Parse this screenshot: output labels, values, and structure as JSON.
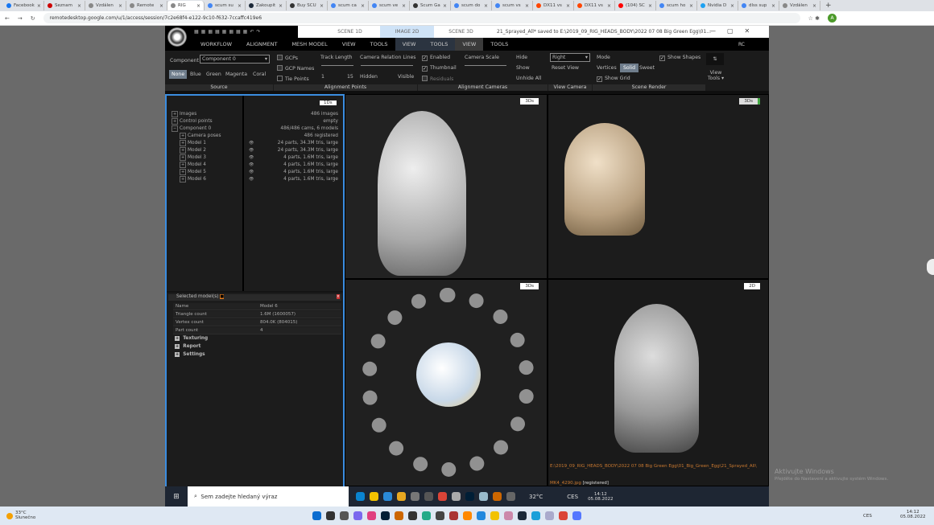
{
  "browser": {
    "tabs": [
      {
        "label": "Facebook",
        "color": "#1877f2"
      },
      {
        "label": "Seznam",
        "color": "#cc0000"
      },
      {
        "label": "Vzdálen",
        "color": "#888888"
      },
      {
        "label": "Remote",
        "color": "#888888"
      },
      {
        "label": "RIG",
        "color": "#888888",
        "active": true
      },
      {
        "label": "scum su",
        "color": "#4285f4"
      },
      {
        "label": "Zakoupit",
        "color": "#1b2838"
      },
      {
        "label": "Buy SCU",
        "color": "#333333"
      },
      {
        "label": "scum ca",
        "color": "#4285f4"
      },
      {
        "label": "scum ve",
        "color": "#4285f4"
      },
      {
        "label": "Scum Ga",
        "color": "#333333"
      },
      {
        "label": "scum do",
        "color": "#4285f4"
      },
      {
        "label": "scum vs",
        "color": "#4285f4"
      },
      {
        "label": "DX11 vs",
        "color": "#ff4500"
      },
      {
        "label": "DX11 vs",
        "color": "#ff4500"
      },
      {
        "label": "(104) SC",
        "color": "#ff0000"
      },
      {
        "label": "scum ho",
        "color": "#4285f4"
      },
      {
        "label": "Nvidia D",
        "color": "#1da1f2"
      },
      {
        "label": "dlss sup",
        "color": "#4285f4"
      },
      {
        "label": "Vzdálen",
        "color": "#888888"
      }
    ],
    "new_tab": "+",
    "url": "remotedesktop.google.com/u/1/access/session/7c2e68f4-e122-9c10-f632-7ccaffc419e6",
    "profile_initial": "A"
  },
  "app": {
    "scene_tabs": [
      "SCENE 1D",
      "IMAGE 2D",
      "SCENE 3D"
    ],
    "title": "21_Sprayed_All* saved to E:\\2019_09_RIG_HEADS_BODY\\2022 07 08 Big Green Egg\\01...",
    "menu": [
      "WORKFLOW",
      "ALIGNMENT",
      "MESH MODEL",
      "VIEW",
      "TOOLS",
      "VIEW",
      "TOOLS",
      "VIEW",
      "TOOLS"
    ],
    "menu_right": "RC",
    "ribbon": {
      "component_label": "Component",
      "component_value": "Component 0",
      "colors": [
        "None",
        "Blue",
        "Green",
        "Magenta",
        "Coral"
      ],
      "gcps": "GCPs",
      "gcp_names": "GCP Names",
      "tie_points": "Tie Points",
      "track_length": "Track Length",
      "track_min": "1",
      "track_max": "15",
      "camera_relation": "Camera Relation Lines",
      "hidden": "Hidden",
      "visible": "Visible",
      "enabled": "Enabled",
      "thumbnail": "Thumbnail",
      "residuals": "Residuals",
      "camera_scale": "Camera Scale",
      "hide": "Hide",
      "show": "Show",
      "unhide_all": "Unhide All",
      "view_select": "Right",
      "reset_view": "Reset View",
      "mode": "Mode",
      "vertices": "Vertices",
      "solid": "Solid",
      "sweet": "Sweet",
      "show_shapes": "Show Shapes",
      "show_grid": "Show Grid",
      "view_tools": "View Tools ▾",
      "groups": [
        "Source",
        "Alignment Points",
        "Alignment Cameras",
        "View Camera",
        "Scene Render"
      ]
    },
    "tree": {
      "badge": "1Ds",
      "items": [
        {
          "label": "Images",
          "value": "486 images",
          "indent": 0
        },
        {
          "label": "Control points",
          "value": "empty",
          "indent": 0
        },
        {
          "label": "Component 0",
          "value": "486/486 cams, 6 models",
          "indent": 0
        },
        {
          "label": "Camera poses",
          "value": "486 registered",
          "indent": 1
        },
        {
          "label": "Model 1",
          "value": "24 parts, 34.3M tris, large",
          "indent": 1
        },
        {
          "label": "Model 2",
          "value": "24 parts, 34.3M tris, large",
          "indent": 1
        },
        {
          "label": "Model 3",
          "value": "4 parts, 1.6M tris, large",
          "indent": 1
        },
        {
          "label": "Model 4",
          "value": "4 parts, 1.6M tris, large",
          "indent": 1
        },
        {
          "label": "Model 5",
          "value": "4 parts, 1.6M tris, large",
          "indent": 1
        },
        {
          "label": "Model 6",
          "value": "4 parts, 1.6M tris, large",
          "indent": 1
        }
      ]
    },
    "selected": {
      "title": "Selected model(s)",
      "rows": [
        [
          "Name",
          "Model 6"
        ],
        [
          "Triangle count",
          "1.6M (1600057)"
        ],
        [
          "Vertex count",
          "804.0K (804015)"
        ],
        [
          "Part count",
          "4"
        ]
      ],
      "sections": [
        "Texturing",
        "Report",
        "Settings"
      ]
    },
    "viewports": {
      "badges": [
        "3Ds",
        "3Ds",
        "3Ds",
        "2D"
      ],
      "image_path": "E:\\2019_09_RIG_HEADS_BODY\\2022 07 08 Big Green Egg\\01_Big_Green_Egg\\21_Sprayed_All\\",
      "image_file": "MK4_4290.jpg",
      "image_status": "[registered]"
    }
  },
  "remote_taskbar": {
    "search_placeholder": "Sem zadejte hledaný výraz",
    "temp": "32°C",
    "lang": "CES",
    "time": "14:12",
    "date": "05.08.2022"
  },
  "windows_taskbar": {
    "weather_temp": "33°C",
    "weather_desc": "Slunečno",
    "lang": "CES",
    "time": "14:12",
    "date": "05.08.2022"
  },
  "watermark": {
    "title": "Aktivujte Windows",
    "subtitle": "Přejděte do Nastavení a aktivujte systém Windows."
  }
}
